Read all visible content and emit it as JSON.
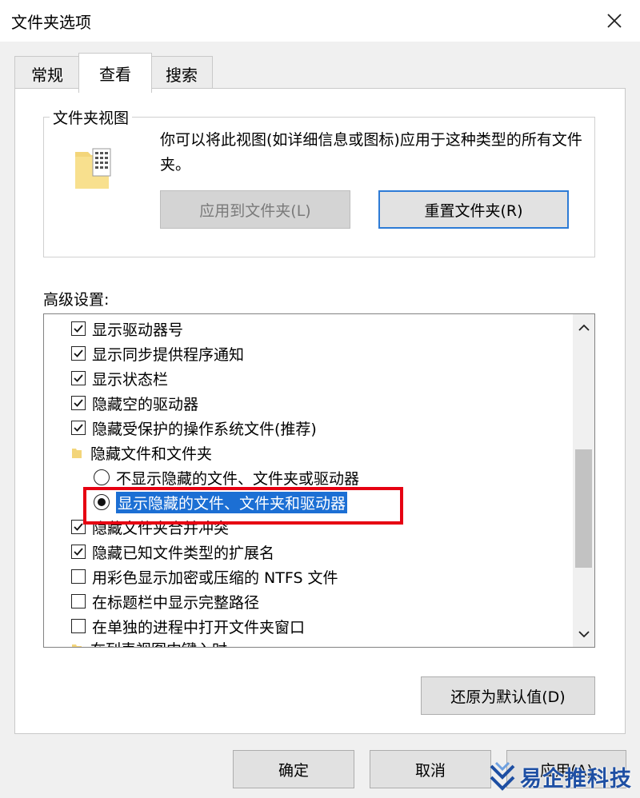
{
  "window": {
    "title": "文件夹选项"
  },
  "tabs": [
    {
      "label": "常规",
      "active": false
    },
    {
      "label": "查看",
      "active": true
    },
    {
      "label": "搜索",
      "active": false
    }
  ],
  "folder_views": {
    "group_label": "文件夹视图",
    "description": "你可以将此视图(如详细信息或图标)应用于这种类型的所有文件夹。",
    "apply_button": "应用到文件夹(L)",
    "reset_button": "重置文件夹(R)"
  },
  "advanced": {
    "label": "高级设置:",
    "items": [
      {
        "kind": "checkbox",
        "checked": true,
        "label": "显示驱动器号"
      },
      {
        "kind": "checkbox",
        "checked": true,
        "label": "显示同步提供程序通知"
      },
      {
        "kind": "checkbox",
        "checked": true,
        "label": "显示状态栏"
      },
      {
        "kind": "checkbox",
        "checked": true,
        "label": "隐藏空的驱动器"
      },
      {
        "kind": "checkbox",
        "checked": true,
        "label": "隐藏受保护的操作系统文件(推荐)"
      },
      {
        "kind": "folder",
        "label": "隐藏文件和文件夹"
      },
      {
        "kind": "radio",
        "checked": false,
        "label": "不显示隐藏的文件、文件夹或驱动器"
      },
      {
        "kind": "radio",
        "checked": true,
        "selected": true,
        "label": "显示隐藏的文件、文件夹和驱动器"
      },
      {
        "kind": "checkbox",
        "checked": true,
        "label": "隐藏文件夹合并冲突"
      },
      {
        "kind": "checkbox",
        "checked": true,
        "label": "隐藏已知文件类型的扩展名"
      },
      {
        "kind": "checkbox",
        "checked": false,
        "label": "用彩色显示加密或压缩的 NTFS 文件"
      },
      {
        "kind": "checkbox",
        "checked": false,
        "label": "在标题栏中显示完整路径"
      },
      {
        "kind": "checkbox",
        "checked": false,
        "label": "在单独的进程中打开文件夹窗口"
      },
      {
        "kind": "folder",
        "label": "在列表视图中键入时"
      }
    ],
    "restore_button": "还原为默认值(D)"
  },
  "footer": {
    "ok": "确定",
    "cancel": "取消",
    "apply": "应用(A)"
  },
  "watermark": {
    "text": "易企推科技"
  },
  "colors": {
    "selection": "#1c6fd4",
    "highlight_box": "#e60012",
    "focus_border": "#2d7bd6"
  }
}
